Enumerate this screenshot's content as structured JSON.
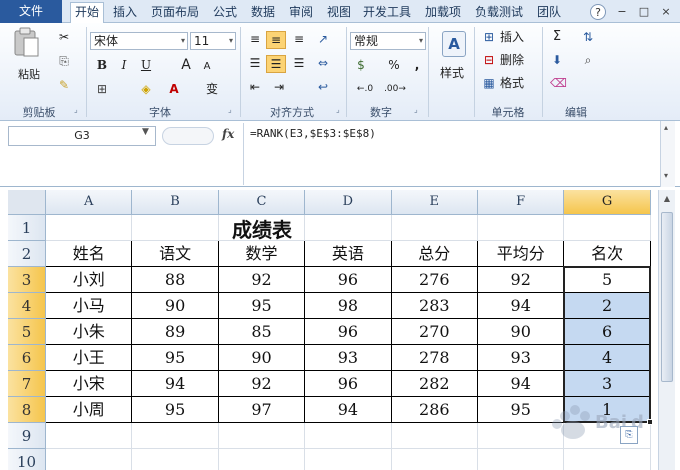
{
  "tabs": [
    "文件",
    "开始",
    "插入",
    "页面布局",
    "公式",
    "数据",
    "审阅",
    "视图",
    "开发工具",
    "加载项",
    "负载测试",
    "团队"
  ],
  "window_icons": [
    "?",
    "−",
    "□",
    "×"
  ],
  "ribbon": {
    "clipboard": {
      "paste": "粘贴",
      "label": "剪贴板"
    },
    "font": {
      "name": "宋体",
      "size": "11",
      "bold": "B",
      "italic": "I",
      "underline": "U",
      "grow": "A",
      "shrink": "A",
      "wen": "变",
      "label": "字体"
    },
    "alignment": {
      "label": "对齐方式"
    },
    "number": {
      "format": "常规",
      "percent": "%",
      "comma": ",",
      "label": "数字"
    },
    "styles": {
      "label": "样式"
    },
    "cells": {
      "insert": "插入",
      "delete": "删除",
      "format": "格式",
      "label": "单元格"
    },
    "editing": {
      "sigma": "Σ",
      "label": "编辑"
    }
  },
  "formula_bar": {
    "name_box": "G3",
    "fx": "fx",
    "formula": "=RANK(E3,$E$3:$E$8)"
  },
  "columns": [
    "A",
    "B",
    "C",
    "D",
    "E",
    "F",
    "G"
  ],
  "rows": [
    "1",
    "2",
    "3",
    "4",
    "5",
    "6",
    "7",
    "8",
    "9",
    "10"
  ],
  "sheet": {
    "title": "成绩表",
    "headers": [
      "姓名",
      "语文",
      "数学",
      "英语",
      "总分",
      "平均分",
      "名次"
    ],
    "data": [
      [
        "小刘",
        "88",
        "92",
        "96",
        "276",
        "92",
        "5"
      ],
      [
        "小马",
        "90",
        "95",
        "98",
        "283",
        "94",
        "2"
      ],
      [
        "小朱",
        "89",
        "85",
        "96",
        "270",
        "90",
        "6"
      ],
      [
        "小王",
        "95",
        "90",
        "93",
        "278",
        "93",
        "4"
      ],
      [
        "小宋",
        "94",
        "92",
        "96",
        "282",
        "94",
        "3"
      ],
      [
        "小周",
        "95",
        "97",
        "94",
        "286",
        "95",
        "1"
      ]
    ]
  },
  "colors": {
    "selection": "#c5d9f1",
    "header_selected": "#f5c54c",
    "file_tab": "#2a5a9e"
  }
}
